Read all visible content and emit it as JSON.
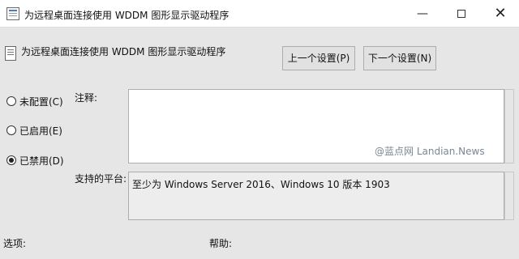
{
  "window": {
    "title": "为远程桌面连接使用 WDDM 图形显示驱动程序",
    "min_glyph": "—",
    "close_glyph": "✕"
  },
  "policy": {
    "name": "为远程桌面连接使用 WDDM 图形显示驱动程序"
  },
  "nav": {
    "prev_label": "上一个设置(P)",
    "next_label": "下一个设置(N)"
  },
  "state": {
    "options": [
      {
        "label": "未配置(C)",
        "checked": false
      },
      {
        "label": "已启用(E)",
        "checked": false
      },
      {
        "label": "已禁用(D)",
        "checked": true
      }
    ]
  },
  "fields": {
    "comment_label": "注释:",
    "comment_value": "",
    "platform_label": "支持的平台:",
    "platform_value": "至少为 Windows Server 2016、Windows 10 版本 1903",
    "options_label": "选项:",
    "help_label": "帮助:"
  },
  "watermark": "@蓝点网 Landian.News",
  "icons": {
    "app": "policy-app-icon",
    "policy": "policy-document-icon"
  }
}
